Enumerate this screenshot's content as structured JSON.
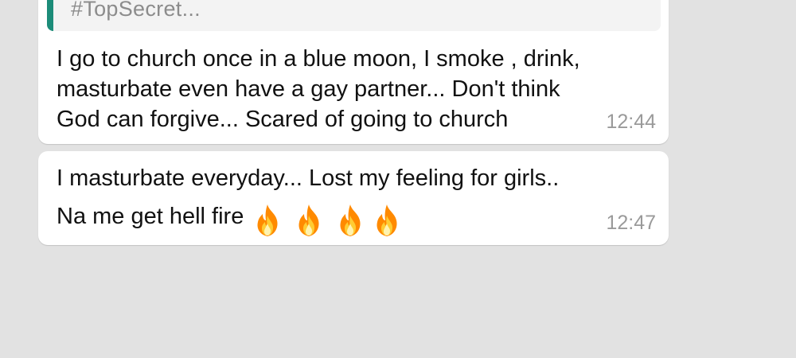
{
  "messages": [
    {
      "quote": "#TopSecret...",
      "lines": [
        "I go to church once in a blue moon, I smoke , drink,",
        "masturbate even have a gay partner... Don't think",
        "God can forgive... Scared of going to church"
      ],
      "time": "12:44"
    },
    {
      "lines": [
        "I masturbate everyday... Lost my feeling for girls..",
        "Na me get hell fire"
      ],
      "emoji": [
        "fire-icon",
        "fire-icon",
        "fire-icon",
        "fire-icon"
      ],
      "time": "12:47"
    }
  ],
  "colors": {
    "background": "#e2e2e2",
    "bubble": "#ffffff",
    "quote_bar": "#1c8c79",
    "timestamp": "#9a9a9a"
  }
}
